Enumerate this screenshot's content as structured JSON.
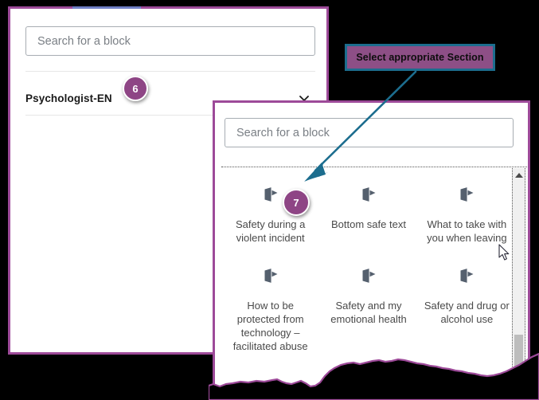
{
  "colors": {
    "panel_border_purple": "#9d4a99",
    "badge_purple": "#8e4585",
    "callout_fill": "#8d4f86",
    "callout_border_teal": "#1c6d8e",
    "arrow_teal": "#1c6d8e",
    "icon_gray": "#55606e",
    "accent_blue": "#6f7fc4"
  },
  "upper_panel": {
    "search": {
      "placeholder": "Search for a block",
      "value": ""
    },
    "section": {
      "label": "Psychologist-EN",
      "chevron_icon": "chevron-down-icon",
      "badge": "6"
    }
  },
  "callout": {
    "text": "Select appropriate Section"
  },
  "lower_panel": {
    "search": {
      "placeholder": "Search for a block",
      "value": ""
    },
    "badge": "7",
    "blocks": [
      {
        "label": "Safety during a violent incident",
        "icon": "block-icon"
      },
      {
        "label": "Bottom safe text",
        "icon": "block-icon"
      },
      {
        "label": "What to take with you when leaving",
        "icon": "block-icon"
      },
      {
        "label": "How to be protected from technology – facilitated abuse",
        "icon": "block-icon"
      },
      {
        "label": "Safety and my emotional health",
        "icon": "block-icon"
      },
      {
        "label": "Safety and drug or alcohol use",
        "icon": "block-icon"
      }
    ],
    "scrollbar": {
      "up_arrow_icon": "scroll-up-arrow-icon"
    }
  },
  "cursor": {
    "icon": "mouse-pointer-icon"
  }
}
